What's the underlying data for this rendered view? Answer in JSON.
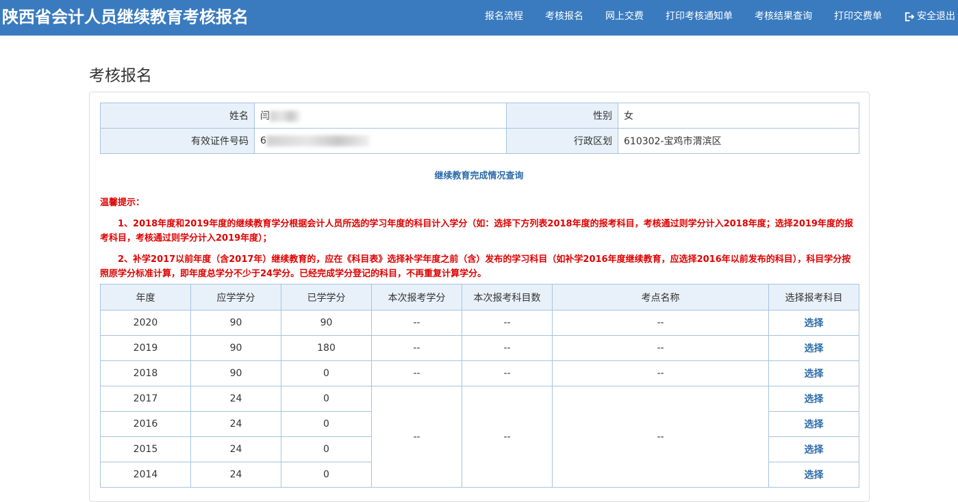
{
  "header": {
    "title": "陕西省会计人员继续教育考核报名",
    "nav": [
      "报名流程",
      "考核报名",
      "网上交费",
      "打印考核通知单",
      "考核结果查询",
      "打印交费单"
    ],
    "logout_label": "安全退出",
    "color": "#3a7bbf"
  },
  "page_title": "考核报名",
  "info": {
    "name_label": "姓名",
    "name_value": "闫",
    "gender_label": "性别",
    "gender_value": "女",
    "id_label": "有效证件号码",
    "id_value": "6",
    "region_label": "行政区划",
    "region_value": "610302-宝鸡市渭滨区"
  },
  "query_link": "继续教育完成情况查询",
  "tips": {
    "title": "温馨提示：",
    "items": [
      "1、2018年度和2019年度的继续教育学分根据会计人员所选的学习年度的科目计入学分（如：选择下方列表2018年度的报考科目，考核通过则学分计入2018年度；选择2019年度的报考科目，考核通过则学分计入2019年度）；",
      "2、补学2017以前年度（含2017年）继续教育的，应在《科目表》选择补学年度之前（含）发布的学习科目（如补学2016年度继续教育，应选择2016年以前发布的科目），科目学分按照原学分标准计算，即年度总学分不少于24学分。已经完成学分登记的科目，不再重复计算学分。"
    ]
  },
  "table": {
    "headers": [
      "年度",
      "应学学分",
      "已学学分",
      "本次报考学分",
      "本次报考科目数",
      "考点名称",
      "选择报考科目"
    ],
    "rows": [
      {
        "year": "2020",
        "required": "90",
        "earned": "90",
        "credits": "--",
        "count": "--",
        "site": "--",
        "action": "选择"
      },
      {
        "year": "2019",
        "required": "90",
        "earned": "180",
        "credits": "--",
        "count": "--",
        "site": "--",
        "action": "选择"
      },
      {
        "year": "2018",
        "required": "90",
        "earned": "0",
        "credits": "--",
        "count": "--",
        "site": "--",
        "action": "选择"
      },
      {
        "year": "2017",
        "required": "24",
        "earned": "0",
        "action": "选择"
      },
      {
        "year": "2016",
        "required": "24",
        "earned": "0",
        "action": "选择"
      },
      {
        "year": "2015",
        "required": "24",
        "earned": "0",
        "action": "选择"
      },
      {
        "year": "2014",
        "required": "24",
        "earned": "0",
        "action": "选择"
      }
    ],
    "merged": {
      "credits": "--",
      "count": "--",
      "site": "--"
    }
  }
}
